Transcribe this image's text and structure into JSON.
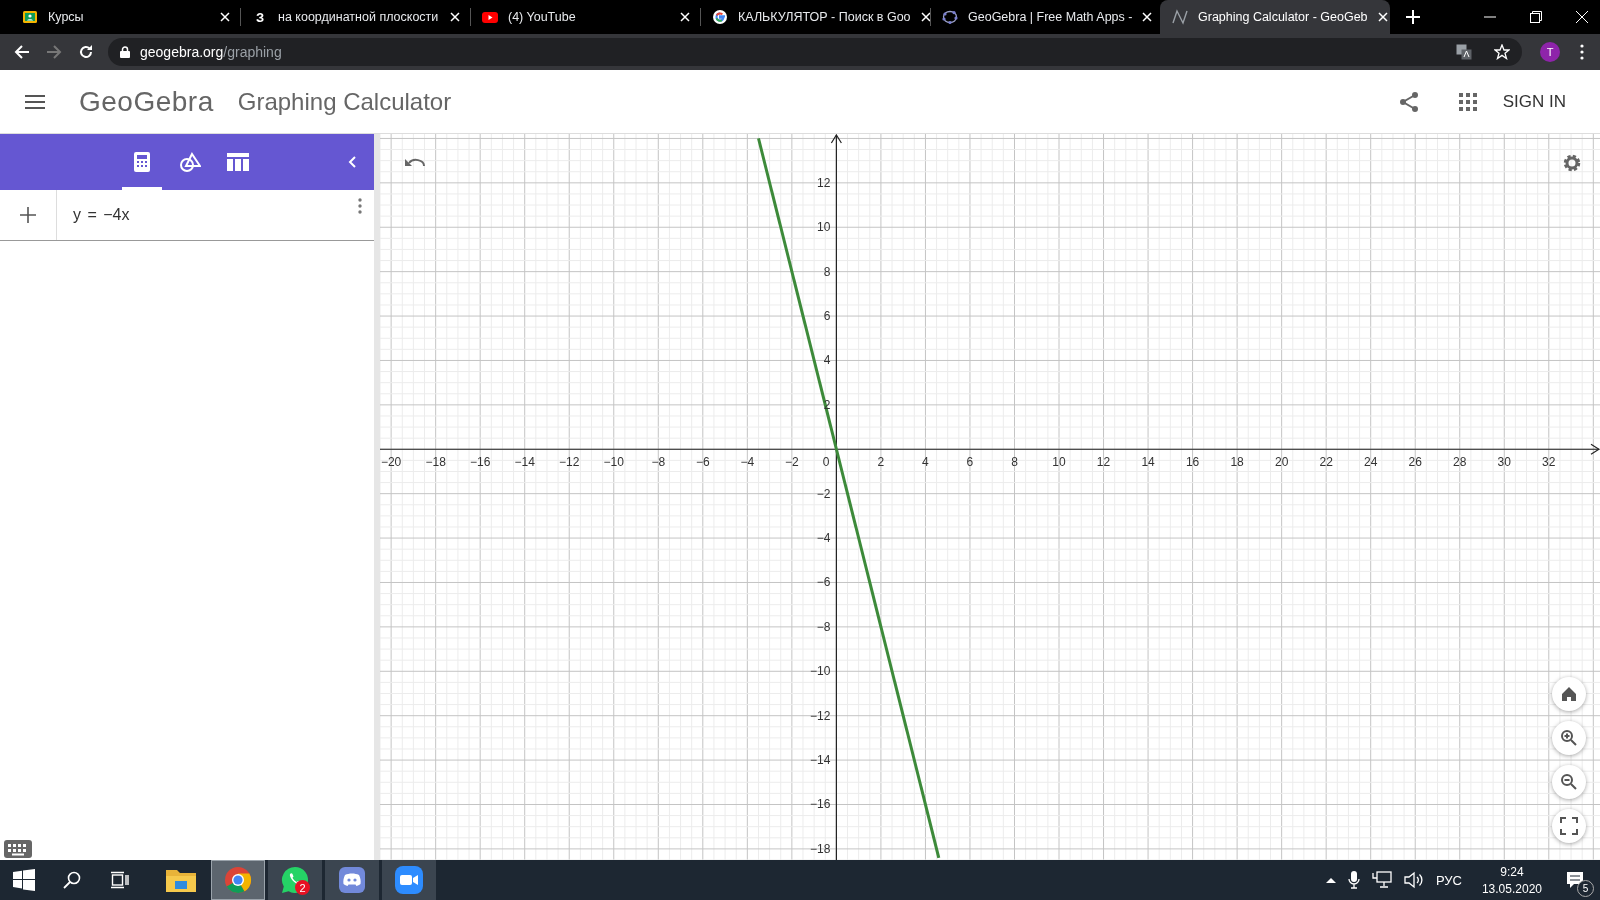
{
  "browser": {
    "tabs": [
      {
        "kind": "classroom",
        "title": "Курсы",
        "selected": false
      },
      {
        "kind": "letter",
        "icon_text": "З",
        "title": "на координатной плоскости",
        "selected": false
      },
      {
        "kind": "youtube",
        "title": "(4) YouTube",
        "selected": false
      },
      {
        "kind": "google",
        "title": "КАЛЬКУЛЯТОР - Поиск в Goo",
        "selected": false
      },
      {
        "kind": "geogebra",
        "title": "GeoGebra | Free Math Apps -",
        "selected": false
      },
      {
        "kind": "graph",
        "title": "Graphing Calculator - GeoGeb",
        "selected": true
      }
    ],
    "address": {
      "host": "geogebra.org",
      "path": "/graphing"
    },
    "profile_initial": "T"
  },
  "header": {
    "logo": "GeoGebra",
    "title": "Graphing Calculator",
    "sign_in": "SIGN IN"
  },
  "sidebar": {
    "views": [
      {
        "kind": "algebra",
        "selected": true
      },
      {
        "kind": "geometry",
        "selected": false
      },
      {
        "kind": "table",
        "selected": false
      }
    ],
    "inputs": [
      {
        "expression": "y = −4x"
      }
    ]
  },
  "graph": {
    "origin_label": "0",
    "chart_data": {
      "type": "line",
      "grid": true,
      "x": [
        -3.5,
        4.6
      ],
      "series": [
        {
          "color": "#3d8a3a",
          "values": [
            14,
            -18.4
          ]
        }
      ],
      "xlim": [
        -20.5,
        34.3
      ],
      "ylim": [
        -18.5,
        14.2
      ],
      "xticks": [
        {
          "value": -20,
          "label": "−20"
        },
        {
          "value": -18,
          "label": "−18"
        },
        {
          "value": -16,
          "label": "−16"
        },
        {
          "value": -14,
          "label": "−14"
        },
        {
          "value": -12,
          "label": "−12"
        },
        {
          "value": -10,
          "label": "−10"
        },
        {
          "value": -8,
          "label": "−8"
        },
        {
          "value": -6,
          "label": "−6"
        },
        {
          "value": -4,
          "label": "−4"
        },
        {
          "value": -2,
          "label": "−2"
        },
        2,
        4,
        6,
        8,
        10,
        12,
        14,
        16,
        18,
        20,
        22,
        24,
        26,
        28,
        30,
        32
      ],
      "yticks": [
        {
          "value": -18,
          "label": "−18"
        },
        {
          "value": -16,
          "label": "−16"
        },
        {
          "value": -14,
          "label": "−14"
        },
        {
          "value": -12,
          "label": "−12"
        },
        {
          "value": -10,
          "label": "−10"
        },
        {
          "value": -8,
          "label": "−8"
        },
        {
          "value": -6,
          "label": "−6"
        },
        {
          "value": -4,
          "label": "−4"
        },
        {
          "value": -2,
          "label": "−2"
        },
        2,
        4,
        6,
        8,
        10,
        12
      ]
    }
  },
  "taskbar": {
    "apps": [
      {
        "kind": "explorer",
        "running": false,
        "active": false
      },
      {
        "kind": "chrome",
        "running": true,
        "active": true
      },
      {
        "kind": "whatsapp",
        "running": true,
        "active": false,
        "badge": "2"
      },
      {
        "kind": "discord",
        "running": true,
        "active": false
      },
      {
        "kind": "zoom",
        "running": true,
        "active": false
      }
    ],
    "language": "РУС",
    "time": "9:24",
    "date": "13.05.2020",
    "notifications": "5"
  }
}
